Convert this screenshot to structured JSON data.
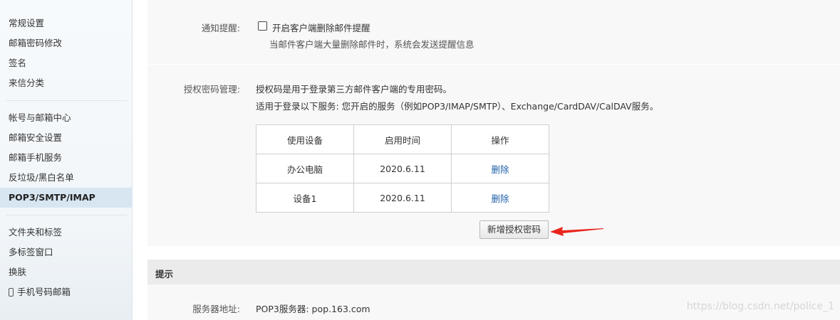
{
  "sidebar": {
    "group1": [
      "常规设置",
      "邮箱密码修改",
      "签名",
      "来信分类"
    ],
    "group2": [
      "帐号与邮箱中心",
      "邮箱安全设置",
      "邮箱手机服务",
      "反垃圾/黑白名单",
      "POP3/SMTP/IMAP"
    ],
    "group3": [
      "文件夹和标签",
      "多标签窗口",
      "换肤"
    ],
    "phone_item": "手机号码邮箱",
    "active": "POP3/SMTP/IMAP"
  },
  "notify": {
    "label": "通知提醒:",
    "checkbox_label": "开启客户端删除邮件提醒",
    "checked": false,
    "hint": "当邮件客户端大量删除邮件时，系统会发送提醒信息"
  },
  "auth": {
    "label": "授权密码管理:",
    "desc1": "授权码是用于登录第三方邮件客户端的专用密码。",
    "desc2": "适用于登录以下服务: 您开启的服务（例如POP3/IMAP/SMTP）、Exchange/CardDAV/CalDAV服务。",
    "table": {
      "headers": [
        "使用设备",
        "启用时间",
        "操作"
      ],
      "rows": [
        {
          "device": "办公电脑",
          "date": "2020.6.11",
          "action": "删除"
        },
        {
          "device": "设备1",
          "date": "2020.6.11",
          "action": "删除"
        }
      ]
    },
    "add_button": "新增授权密码"
  },
  "tips": {
    "title": "提示",
    "server_label": "服务器地址:",
    "pop3_server": "POP3服务器: pop.163.com"
  },
  "watermark": "https://blog.csdn.net/police_1",
  "colors": {
    "arrow": "#e8261e",
    "link": "#1f5fa8",
    "active_bg": "#d8e6f2"
  }
}
